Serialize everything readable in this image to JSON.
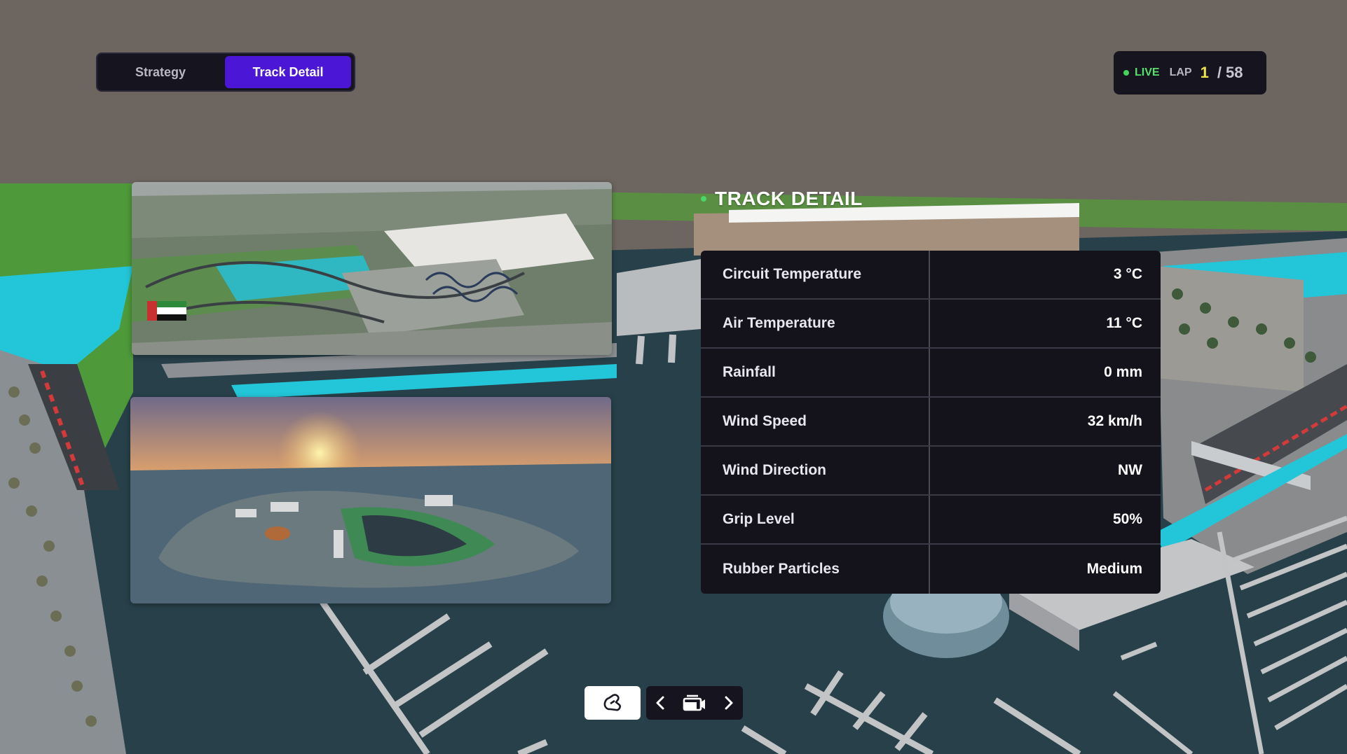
{
  "tabs": {
    "strategy_label": "Strategy",
    "track_detail_label": "Track Detail",
    "active": "Track Detail"
  },
  "live": {
    "live_label": "LIVE",
    "lap_label": "LAP",
    "current_lap": "1",
    "total_laps": "/ 58"
  },
  "track_detail": {
    "heading": "TRACK DETAIL",
    "stats": [
      {
        "label": "Circuit Temperature",
        "value": "3 °C"
      },
      {
        "label": "Air Temperature",
        "value": "11 °C"
      },
      {
        "label": "Rainfall",
        "value": "0 mm"
      },
      {
        "label": "Wind Speed",
        "value": "32 km/h"
      },
      {
        "label": "Wind Direction",
        "value": "NW"
      },
      {
        "label": "Grip Level",
        "value": "50%"
      },
      {
        "label": "Rubber Particles",
        "value": "Medium"
      }
    ]
  },
  "controls": {
    "track_icon": "track-map-icon",
    "prev_icon": "chevron-left-icon",
    "camera_icon": "camera-icon",
    "next_icon": "chevron-right-icon"
  },
  "colors": {
    "accent": "#4b16d6",
    "live_green": "#54e06a",
    "lap_yellow": "#f2e04a",
    "panel": "#14131c",
    "sky": "#6d655f",
    "water": "#28404a",
    "grass": "#4e9a3a",
    "pool_cyan": "#27c7d9"
  }
}
